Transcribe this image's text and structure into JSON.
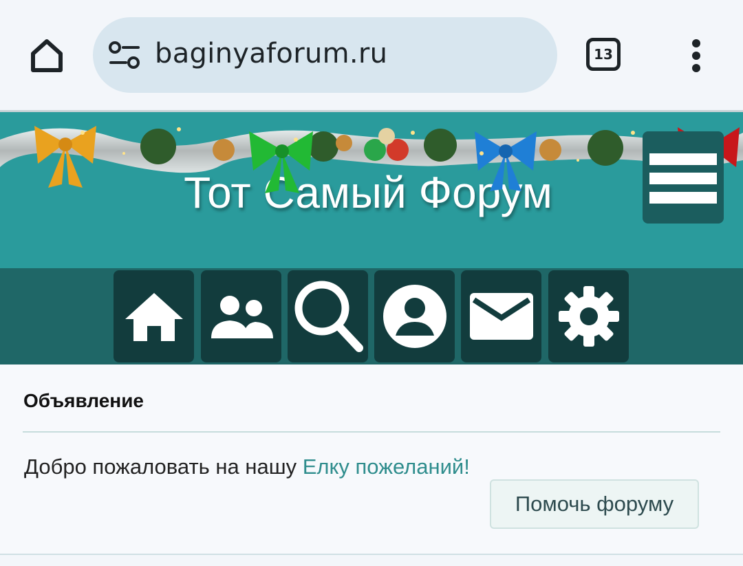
{
  "browser": {
    "url": "baginyaforum.ru",
    "tab_count": "13",
    "icons": [
      "home-icon",
      "site-settings-icon",
      "tab-switcher-icon",
      "more-vert-icon"
    ]
  },
  "site": {
    "title": "Тот Самый Форум",
    "header_color": "#2a9b9c",
    "nav_color": "#1f6767"
  },
  "nav": {
    "items": [
      {
        "icon": "home-icon"
      },
      {
        "icon": "users-icon"
      },
      {
        "icon": "search-icon"
      },
      {
        "icon": "profile-icon"
      },
      {
        "icon": "mail-icon"
      },
      {
        "icon": "gear-icon"
      }
    ]
  },
  "announcement": {
    "title": "Объявление",
    "text_prefix": "Добро пожаловать на нашу ",
    "link_text": "Елку пожеланий!",
    "button_label": "Помочь форуму"
  }
}
